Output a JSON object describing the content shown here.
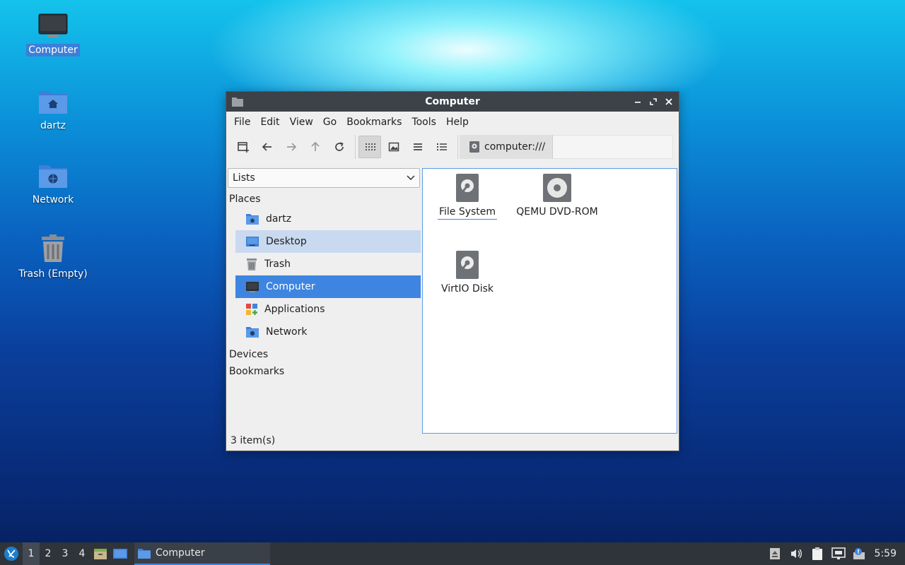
{
  "desktop": {
    "icons": [
      {
        "label": "Computer"
      },
      {
        "label": "dartz"
      },
      {
        "label": "Network"
      },
      {
        "label": "Trash (Empty)"
      }
    ]
  },
  "window": {
    "title": "Computer",
    "menu": [
      "File",
      "Edit",
      "View",
      "Go",
      "Bookmarks",
      "Tools",
      "Help"
    ],
    "location": "computer:///",
    "sidebar": {
      "mode": "Lists",
      "sections": {
        "places": "Places",
        "devices": "Devices",
        "bookmarks": "Bookmarks"
      },
      "places": [
        "dartz",
        "Desktop",
        "Trash",
        "Computer",
        "Applications",
        "Network"
      ]
    },
    "files": [
      "File System",
      "QEMU DVD-ROM",
      "VirtIO Disk"
    ],
    "status": "3 item(s)"
  },
  "taskbar": {
    "desktops": [
      "1",
      "2",
      "3",
      "4"
    ],
    "task_label": "Computer",
    "clock": "5:59"
  },
  "colors": {
    "accent": "#3d85e0",
    "titlebar": "#3d4148",
    "taskbar": "#2f343b"
  }
}
